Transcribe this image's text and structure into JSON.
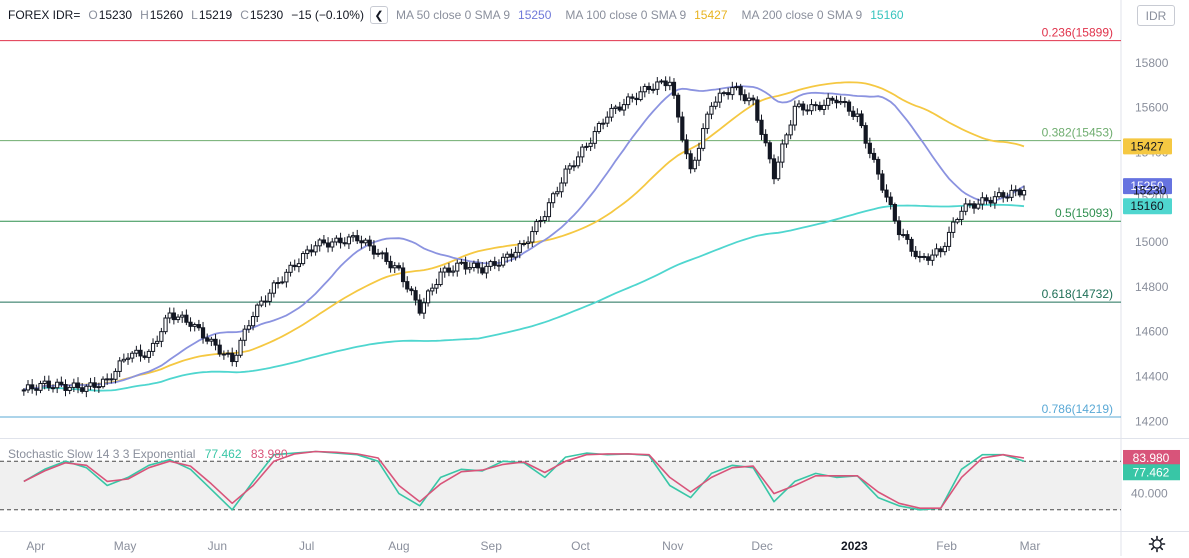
{
  "header": {
    "symbol": "FOREX IDR=",
    "o_label": "O",
    "open": "15230",
    "h_label": "H",
    "high": "15260",
    "l_label": "L",
    "low": "15219",
    "c_label": "C",
    "close": "15230",
    "change": "−15 (−0.10%)",
    "collapse_icon": "chevron-left-icon",
    "ma50_label": "MA 50 close 0 SMA 9",
    "ma50_value": "15250",
    "ma100_label": "MA 100 close 0 SMA 9",
    "ma100_value": "15427",
    "ma200_label": "MA 200 close 0 SMA 9",
    "ma200_value": "15160"
  },
  "currency_button": "IDR",
  "settings_icon": "gear-icon",
  "colors": {
    "up": "#131722",
    "down": "#131722",
    "ma50": "#8b93e0",
    "ma100": "#f5c842",
    "ma200": "#4fd6cf",
    "stoch_k": "#38c6a6",
    "stoch_d": "#d8547a",
    "fib_0236": "#e0334b",
    "fib_0382": "#6fad6f",
    "fib_05": "#2f8f4f",
    "fib_0618": "#1f6f57",
    "fib_0786": "#5aa9d6"
  },
  "chart_data": [
    {
      "type": "candlestick",
      "title": "FOREX IDR=",
      "x_axis_labels": [
        "Apr",
        "May",
        "Jun",
        "Jul",
        "Aug",
        "Sep",
        "Oct",
        "Nov",
        "Dec",
        "2023",
        "Feb",
        "Mar"
      ],
      "y_ticks": [
        14200,
        14400,
        14600,
        14800,
        15000,
        15200,
        15400,
        15600,
        15800
      ],
      "ylim": [
        14130,
        15960
      ],
      "grid": false,
      "fib_levels": [
        {
          "label": "0.236(15899)",
          "value": 15899
        },
        {
          "label": "0.382(15453)",
          "value": 15453
        },
        {
          "label": "0.5(15093)",
          "value": 15093
        },
        {
          "label": "0.618(14732)",
          "value": 14732
        },
        {
          "label": "0.786(14219)",
          "value": 14219
        }
      ],
      "price_labels": [
        {
          "series": "MA 100",
          "value": 15427,
          "text": "15427"
        },
        {
          "series": "MA 50",
          "value": 15250,
          "text": "15250"
        },
        {
          "series": "Close",
          "value": 15230,
          "text": "15230"
        },
        {
          "series": "MA 200",
          "value": 15160,
          "text": "15160"
        }
      ],
      "close_series": {
        "x": [
          "2022-03-28",
          "2022-04-04",
          "2022-04-11",
          "2022-04-18",
          "2022-04-25",
          "2022-05-02",
          "2022-05-09",
          "2022-05-16",
          "2022-05-23",
          "2022-05-30",
          "2022-06-06",
          "2022-06-13",
          "2022-06-20",
          "2022-06-27",
          "2022-07-04",
          "2022-07-11",
          "2022-07-18",
          "2022-07-25",
          "2022-08-01",
          "2022-08-08",
          "2022-08-15",
          "2022-08-22",
          "2022-08-29",
          "2022-09-05",
          "2022-09-12",
          "2022-09-19",
          "2022-09-26",
          "2022-10-03",
          "2022-10-10",
          "2022-10-17",
          "2022-10-24",
          "2022-10-31",
          "2022-11-07",
          "2022-11-14",
          "2022-11-21",
          "2022-11-28",
          "2022-12-05",
          "2022-12-12",
          "2022-12-19",
          "2022-12-26",
          "2023-01-02",
          "2023-01-09",
          "2023-01-16",
          "2023-01-23",
          "2023-01-30",
          "2023-02-06",
          "2023-02-13",
          "2023-02-20",
          "2023-02-27"
        ],
        "close": [
          14340,
          14365,
          14355,
          14350,
          14380,
          14500,
          14500,
          14680,
          14640,
          14550,
          14470,
          14680,
          14800,
          14900,
          14990,
          15000,
          15020,
          14950,
          14870,
          14700,
          14860,
          14900,
          14880,
          14920,
          14990,
          15130,
          15310,
          15430,
          15570,
          15630,
          15690,
          15720,
          15310,
          15620,
          15690,
          15620,
          15300,
          15600,
          15600,
          15640,
          15560,
          15300,
          15050,
          14920,
          14960,
          15150,
          15180,
          15210,
          15230
        ],
        "ylabel": "IDR"
      },
      "series": [
        {
          "name": "MA 50 close 0 SMA 9",
          "last": 15250
        },
        {
          "name": "MA 100 close 0 SMA 9",
          "last": 15427
        },
        {
          "name": "MA 200 close 0 SMA 9",
          "last": 15160
        }
      ]
    },
    {
      "type": "line",
      "title": "Stochastic Slow 14 3 3 Exponential",
      "values_printed": {
        "k": "77.462",
        "d": "83.980"
      },
      "y_ticks": [
        40.0
      ],
      "y_tick_labels": [
        "40.000"
      ],
      "bands": [
        20,
        80
      ],
      "series_approx": {
        "x": [
          "2022-03-28",
          "2022-04-04",
          "2022-04-11",
          "2022-04-18",
          "2022-04-25",
          "2022-05-02",
          "2022-05-09",
          "2022-05-16",
          "2022-05-23",
          "2022-05-30",
          "2022-06-06",
          "2022-06-13",
          "2022-06-20",
          "2022-06-27",
          "2022-07-04",
          "2022-07-11",
          "2022-07-18",
          "2022-07-25",
          "2022-08-01",
          "2022-08-08",
          "2022-08-15",
          "2022-08-22",
          "2022-08-29",
          "2022-09-05",
          "2022-09-12",
          "2022-09-19",
          "2022-09-26",
          "2022-10-03",
          "2022-10-10",
          "2022-10-17",
          "2022-10-24",
          "2022-10-31",
          "2022-11-07",
          "2022-11-14",
          "2022-11-21",
          "2022-11-28",
          "2022-12-05",
          "2022-12-12",
          "2022-12-19",
          "2022-12-26",
          "2023-01-02",
          "2023-01-09",
          "2023-01-16",
          "2023-01-23",
          "2023-01-30",
          "2023-02-06",
          "2023-02-13",
          "2023-02-20",
          "2023-02-27"
        ],
        "k": [
          55,
          70,
          80,
          72,
          50,
          60,
          75,
          82,
          70,
          45,
          20,
          55,
          88,
          90,
          92,
          90,
          88,
          80,
          40,
          25,
          60,
          70,
          68,
          80,
          78,
          60,
          85,
          90,
          88,
          89,
          87,
          50,
          35,
          65,
          75,
          72,
          30,
          55,
          65,
          60,
          62,
          35,
          25,
          20,
          22,
          70,
          88,
          88,
          80
        ],
        "d": [
          55,
          68,
          78,
          75,
          55,
          58,
          72,
          80,
          74,
          52,
          28,
          50,
          80,
          89,
          92,
          91,
          89,
          84,
          50,
          30,
          52,
          67,
          69,
          76,
          79,
          66,
          80,
          88,
          89,
          89,
          88,
          60,
          42,
          60,
          72,
          74,
          40,
          50,
          62,
          62,
          62,
          42,
          28,
          22,
          22,
          60,
          84,
          88,
          84
        ]
      }
    }
  ]
}
